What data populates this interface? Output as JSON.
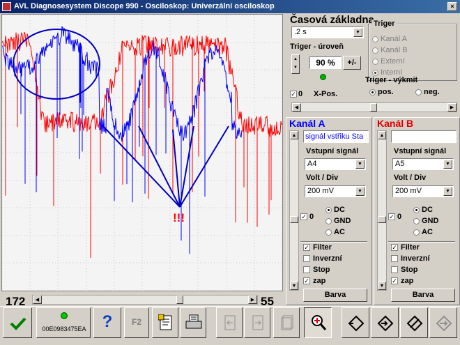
{
  "window": {
    "title": "AVL Diagnosesystem Discope 990 - Osciloskop: Univerzální osciloskop"
  },
  "scope": {
    "left_value": "172",
    "right_value": "55",
    "annotation": "!!!"
  },
  "timebase": {
    "title": "Časová základna",
    "value": ".2 s"
  },
  "trigger": {
    "level_title": "Triger - úroveň",
    "level_value": "90 %",
    "sign_button": "+/-",
    "group_title": "Triger",
    "sources": [
      "Kanál A",
      "Kanál B",
      "Externí",
      "Interní"
    ],
    "xpos_value": "0",
    "xpos_label": "X-Pos.",
    "edge_title": "Triger - výkmit",
    "edge_pos": "pos.",
    "edge_neg": "neg."
  },
  "channel_a": {
    "title": "Kanál A",
    "name": "signál vstřiku Sta",
    "input_label": "Vstupní signál",
    "input_value": "A4",
    "volt_label": "Volt / Div",
    "volt_value": "200 mV",
    "offset_value": "0",
    "coupling": [
      "DC",
      "GND",
      "AC"
    ],
    "options": [
      "Filter",
      "Inverzní",
      "Stop",
      "zap"
    ],
    "color_button": "Barva",
    "color": "#0000ff"
  },
  "channel_b": {
    "title": "Kanál B",
    "name": "",
    "input_label": "Vstupní signál",
    "input_value": "A5",
    "volt_label": "Volt / Div",
    "volt_value": "200 mV",
    "offset_value": "0",
    "coupling": [
      "DC",
      "GND",
      "AC"
    ],
    "options": [
      "Filter",
      "Inverzní",
      "Stop",
      "zap"
    ],
    "color_button": "Barva",
    "color": "#e00000"
  },
  "toolbar": {
    "device_id": "00E0983475EA",
    "f2_label": "F2"
  },
  "colors": {
    "channel_a": "#0000ff",
    "channel_b": "#ff0000",
    "grid": "#c8c8c8",
    "annotation": "#ff0000"
  }
}
